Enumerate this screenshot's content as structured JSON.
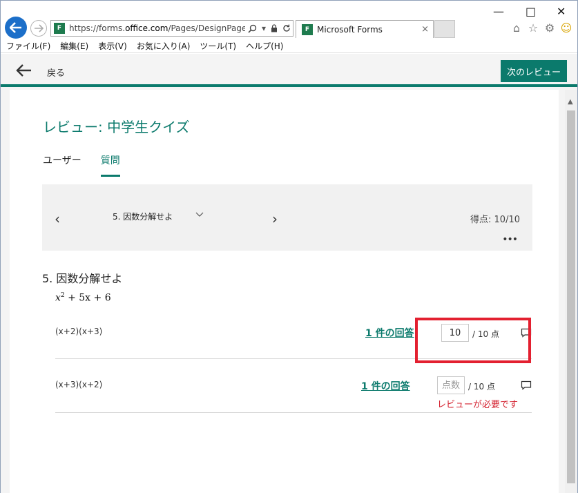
{
  "browser": {
    "url_prefix": "https://forms.",
    "url_domain": "office.com",
    "url_suffix": "/Pages/DesignPage.aspx",
    "favicon_text": "F",
    "tab_title": "Microsoft Forms",
    "tab_close": "×",
    "icons": [
      "back-icon",
      "forward-icon",
      "search-icon",
      "dropdown-icon",
      "lock-icon",
      "refresh-icon",
      "home-icon",
      "favorites-star-icon",
      "settings-gear-icon",
      "smiley-feedback-icon"
    ],
    "window_controls": {
      "minimize": "—",
      "maximize": "□",
      "close": "✕"
    }
  },
  "menu": [
    {
      "label": "ファイル(F)"
    },
    {
      "label": "編集(E)"
    },
    {
      "label": "表示(V)"
    },
    {
      "label": "お気に入り(A)"
    },
    {
      "label": "ツール(T)"
    },
    {
      "label": "ヘルプ(H)"
    }
  ],
  "header": {
    "back_label": "戻る",
    "next_review_label": "次のレビュー"
  },
  "review": {
    "title": "レビュー: 中学生クイズ",
    "tabs": [
      {
        "label": "ユーザー",
        "active": false
      },
      {
        "label": "質問",
        "active": true
      }
    ],
    "question_nav": {
      "prev": "‹",
      "selected": "5. 因数分解せよ",
      "next": "›",
      "score": "得点: 10/10",
      "more": "•••"
    },
    "question_title": "5. 因数分解せよ",
    "formula": {
      "base": "x",
      "exp": "2",
      "rest": " + 5x + 6"
    },
    "answers": [
      {
        "text": "(x+2)(x+3)",
        "responses": "1 件の回答",
        "points_value": "10",
        "out_of": "/ 10 点",
        "required_msg": ""
      },
      {
        "text": "(x+3)(x+2)",
        "responses": "1 件の回答",
        "points_placeholder": "点数",
        "points_value": "",
        "out_of": "/ 10 点",
        "required_msg": "レビューが必要です"
      }
    ]
  },
  "colors": {
    "accent": "#0b7a6c",
    "error": "#d31f2d",
    "highlight": "#e32030"
  }
}
